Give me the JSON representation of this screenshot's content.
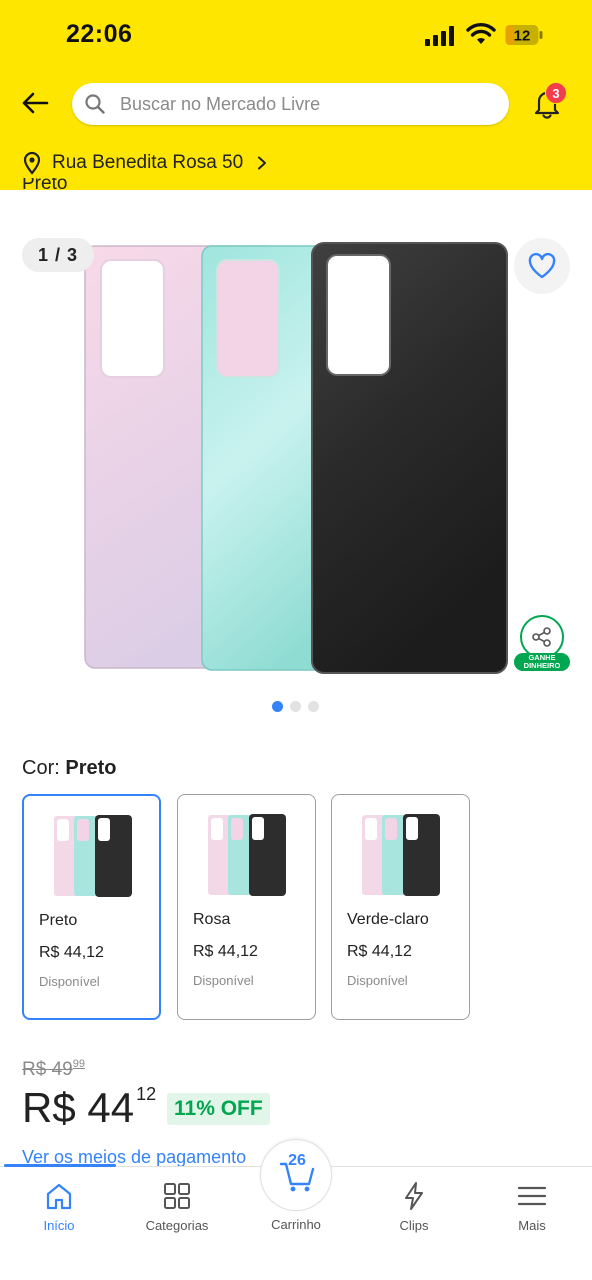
{
  "status_bar": {
    "time": "22:06",
    "battery": "12"
  },
  "header": {
    "search_placeholder": "Buscar no Mercado Livre",
    "notifications_count": "3",
    "address": "Rua Benedita Rosa 50"
  },
  "gallery": {
    "cut_label": "Preto",
    "counter": "1 / 3",
    "share_label": "GANHE DINHEIRO",
    "dots_total": 3,
    "dots_active": 1
  },
  "color_selector": {
    "label_prefix": "Cor:",
    "selected": "Preto",
    "variants": [
      {
        "name": "Preto",
        "price": "R$ 44,12",
        "stock": "Disponível"
      },
      {
        "name": "Rosa",
        "price": "R$ 44,12",
        "stock": "Disponível"
      },
      {
        "name": "Verde-claro",
        "price": "R$ 44,12",
        "stock": "Disponível"
      }
    ]
  },
  "pricing": {
    "old_price": "R$ 49",
    "old_cents": "99",
    "price": "R$ 44",
    "price_cents": "12",
    "discount": "11% OFF",
    "payment_link": "Ver os meios de pagamento"
  },
  "bottom_nav": {
    "items": [
      {
        "label": "Início",
        "icon": "home-icon"
      },
      {
        "label": "Categorias",
        "icon": "grid-icon"
      },
      {
        "label": "Carrinho",
        "icon": "cart-icon"
      },
      {
        "label": "Clips",
        "icon": "clips-icon"
      },
      {
        "label": "Mais",
        "icon": "menu-icon"
      }
    ],
    "cart_count": "26"
  },
  "colors": {
    "header_yellow": "#ffe600",
    "accent_blue": "#3483fa",
    "success_green": "#00a650",
    "badge_red": "#f23d4f"
  }
}
